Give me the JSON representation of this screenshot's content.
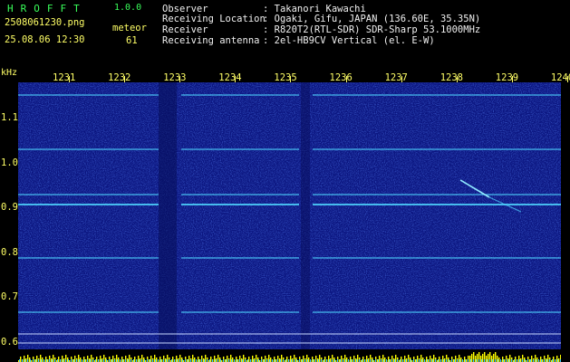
{
  "app": {
    "name": "HROFFT",
    "version": "1.0.0"
  },
  "file": {
    "name": "2508061230.png",
    "datetime": "25.08.06 12:30"
  },
  "meteor": {
    "label": "meteor",
    "count": "61"
  },
  "info": [
    {
      "key": "Observer",
      "value": ": Takanori Kawachi"
    },
    {
      "key": "Receiving Location",
      "value": ": Ogaki, Gifu, JAPAN (136.60E, 35.35N)"
    },
    {
      "key": "Receiver",
      "value": ": R820T2(RTL-SDR) SDR-Sharp 53.1000MHz"
    },
    {
      "key": "Receiving antenna",
      "value": ": 2el-HB9CV Vertical (el. E-W)"
    }
  ],
  "axis": {
    "y_unit": "kHz",
    "y_ticks": [
      "1.1",
      "1.0",
      "0.9",
      "0.8",
      "0.7",
      "0.6"
    ],
    "y_values": [
      1.1,
      1.0,
      0.9,
      0.8,
      0.7,
      0.6
    ],
    "x_ticks": [
      "1231",
      "1232",
      "1233",
      "1234",
      "1235",
      "1236",
      "1237",
      "1238",
      "1239",
      "1240"
    ]
  },
  "colors": {
    "background": "#0b1580",
    "label": "#ffff66",
    "title": "#39ff5a",
    "signal": "#4fd6ff",
    "bar": "#ffff00"
  }
}
